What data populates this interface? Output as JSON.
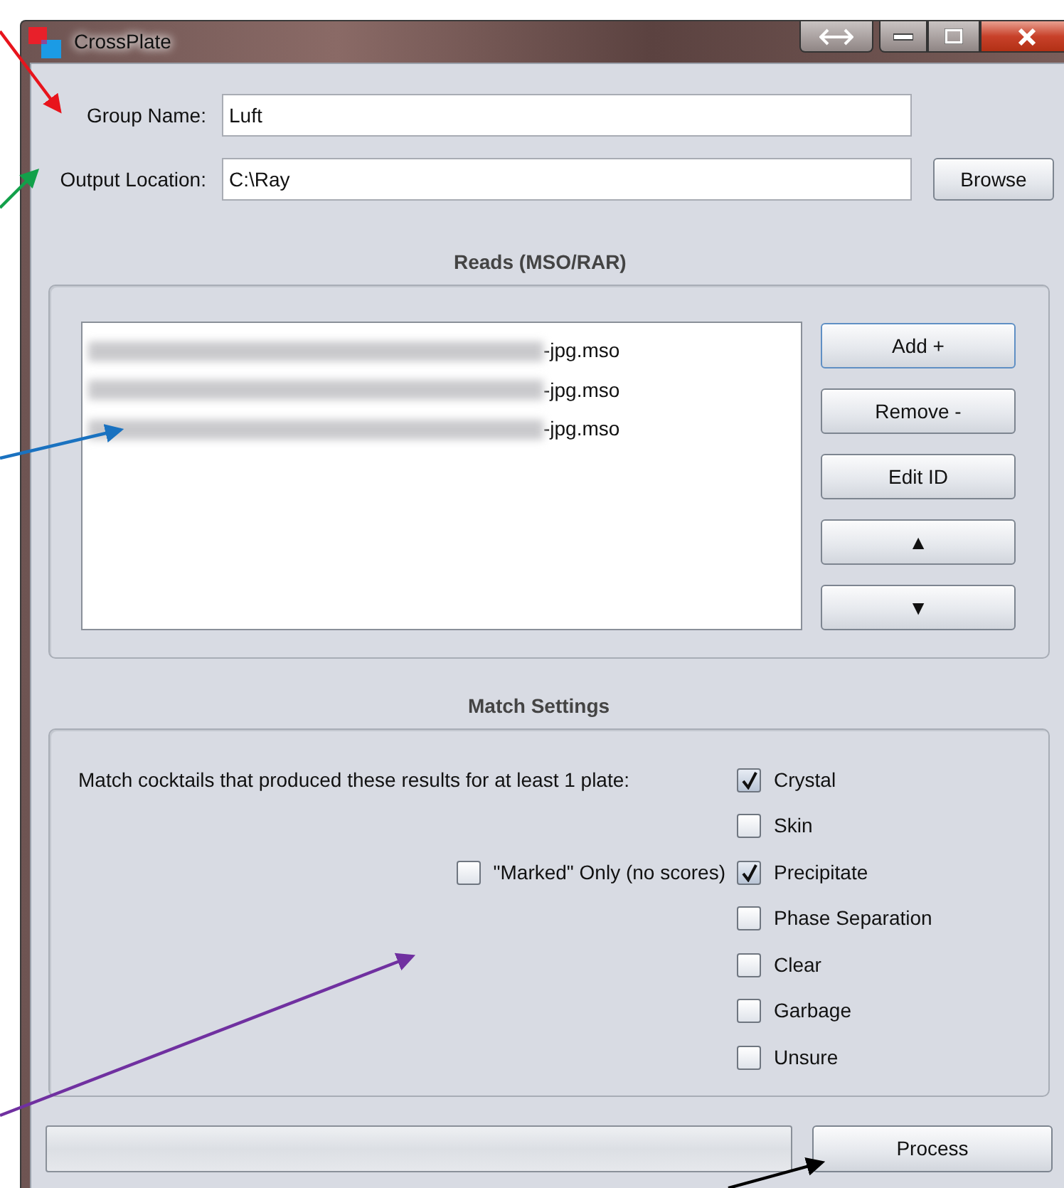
{
  "window": {
    "title": "CrossPlate"
  },
  "group_name": {
    "label": "Group Name:",
    "value": "Luft"
  },
  "output_location": {
    "label": "Output Location:",
    "value": "C:\\Ray",
    "button": "Browse"
  },
  "reads": {
    "title": "Reads (MSO/RAR)",
    "files": [
      {
        "name": "-jpg.mso"
      },
      {
        "name": "-jpg.mso"
      },
      {
        "name": "-jpg.mso"
      }
    ],
    "buttons": [
      "Add +",
      "Remove -",
      "Edit ID",
      "▲",
      "▼"
    ]
  },
  "match_settings": {
    "title": "Match Settings",
    "prompt": "Match cocktails that produced these results for at least 1 plate:",
    "marked_only": {
      "label": "\"Marked\" Only (no scores)",
      "checked": false
    },
    "results": [
      {
        "label": "Crystal",
        "checked": true
      },
      {
        "label": "Skin",
        "checked": false
      },
      {
        "label": "Precipitate",
        "checked": true
      },
      {
        "label": "Phase Separation",
        "checked": false
      },
      {
        "label": "Clear",
        "checked": false
      },
      {
        "label": "Garbage",
        "checked": false
      },
      {
        "label": "Unsure",
        "checked": false
      }
    ]
  },
  "progress": {
    "level": 0
  },
  "process_button": "Process"
}
